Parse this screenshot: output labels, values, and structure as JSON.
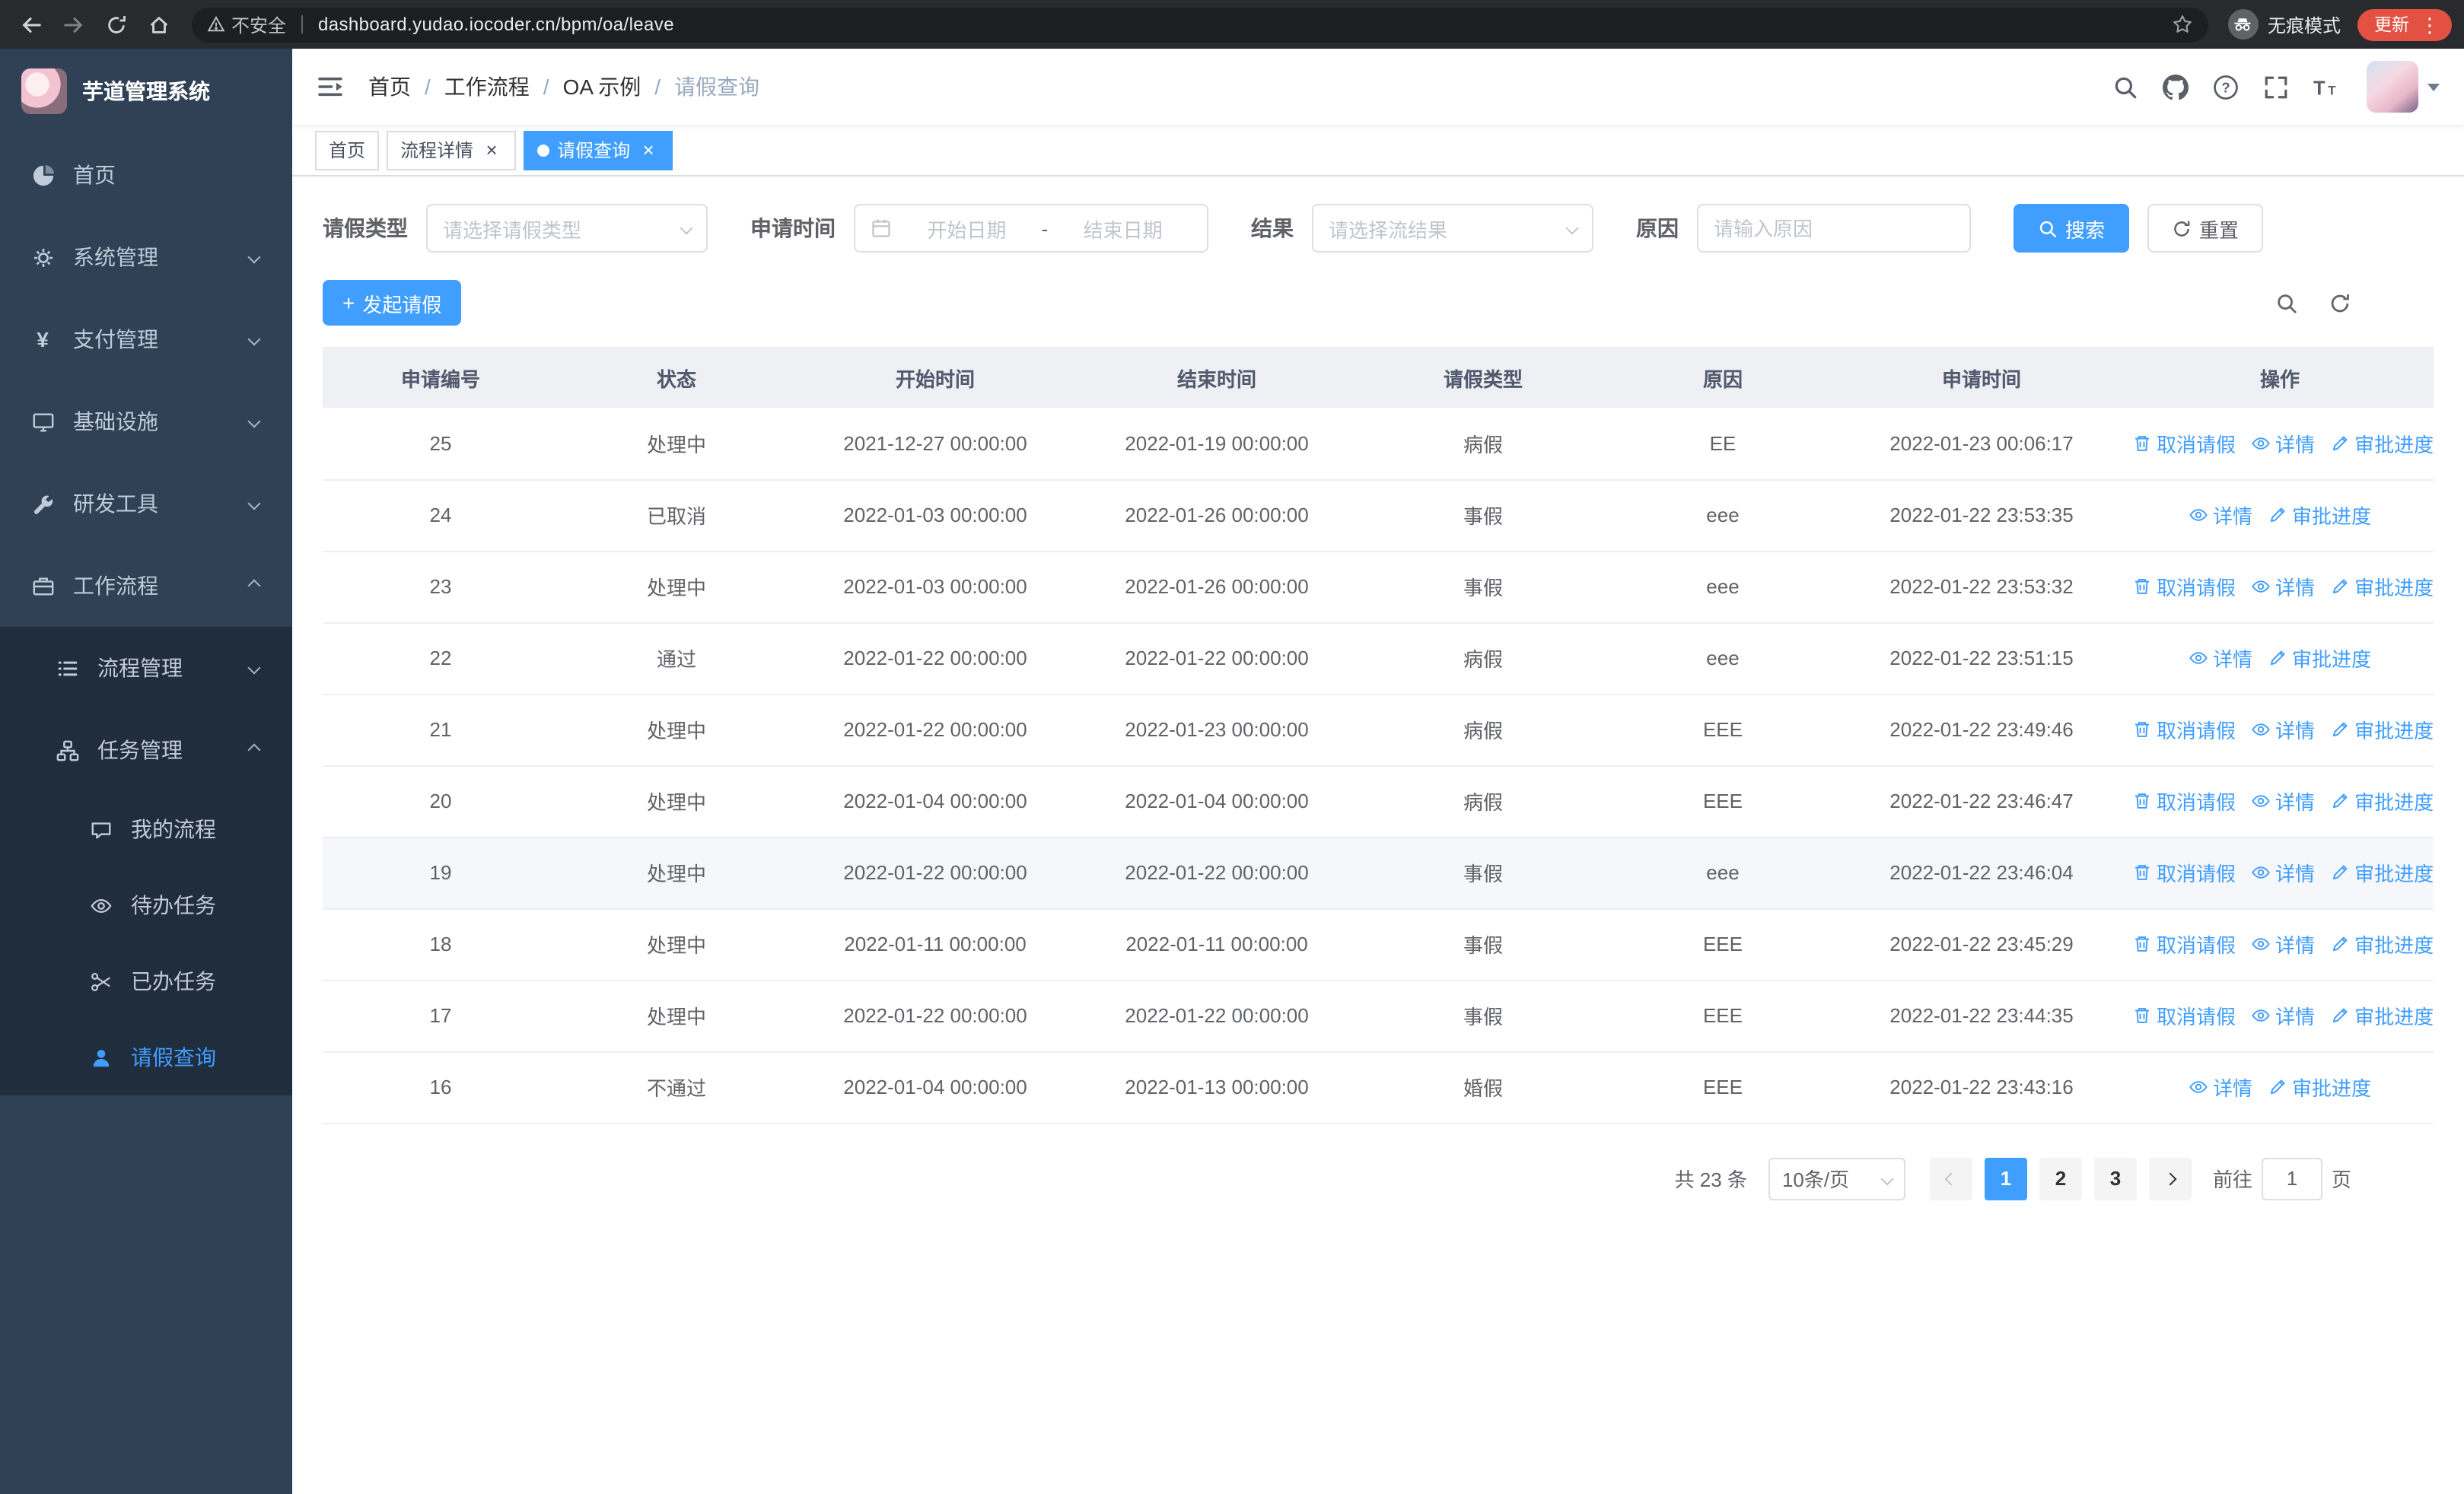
{
  "colors": {
    "primary": "#409eff",
    "sidebar_bg": "#304156",
    "submenu_bg": "#1f2d3d",
    "table_border": "#ebeef5",
    "header_bg": "#eef0f4"
  },
  "browser": {
    "security_warning": "不安全",
    "url": "dashboard.yudao.iocoder.cn/bpm/oa/leave",
    "incognito_label": "无痕模式",
    "update_label": "更新"
  },
  "sidebar": {
    "title": "芋道管理系统",
    "menu": [
      {
        "id": "home",
        "label": "首页",
        "icon": "dashboard"
      },
      {
        "id": "system",
        "label": "系统管理",
        "icon": "gear",
        "group": true
      },
      {
        "id": "payment",
        "label": "支付管理",
        "icon": "yen",
        "group": true
      },
      {
        "id": "infrastructure",
        "label": "基础设施",
        "icon": "monitor",
        "group": true
      },
      {
        "id": "devtools",
        "label": "研发工具",
        "icon": "tools",
        "group": true
      },
      {
        "id": "workflow",
        "label": "工作流程",
        "icon": "briefcase",
        "group": true,
        "expanded": true,
        "children": [
          {
            "id": "process-mgmt",
            "label": "流程管理",
            "icon": "list",
            "group": true
          },
          {
            "id": "task-mgmt",
            "label": "任务管理",
            "icon": "tree",
            "group": true,
            "expanded": true,
            "children": [
              {
                "id": "my-process",
                "label": "我的流程",
                "icon": "chat"
              },
              {
                "id": "todo-tasks",
                "label": "待办任务",
                "icon": "eye"
              },
              {
                "id": "done-tasks",
                "label": "已办任务",
                "icon": "scissors"
              },
              {
                "id": "leave-query",
                "label": "请假查询",
                "icon": "user",
                "active": true
              }
            ]
          }
        ]
      }
    ]
  },
  "header": {
    "breadcrumb": [
      "首页",
      "工作流程",
      "OA 示例",
      "请假查询"
    ],
    "separator": "/"
  },
  "tabs": [
    {
      "name": "home",
      "label": "首页",
      "closable": false,
      "active": false
    },
    {
      "name": "process-detail",
      "label": "流程详情",
      "closable": true,
      "active": false
    },
    {
      "name": "leave-query",
      "label": "请假查询",
      "closable": true,
      "active": true
    }
  ],
  "filters": {
    "leave_type_label": "请假类型",
    "leave_type_placeholder": "请选择请假类型",
    "apply_time_label": "申请时间",
    "start_date_placeholder": "开始日期",
    "range_separator": "-",
    "end_date_placeholder": "结束日期",
    "result_label": "结果",
    "result_placeholder": "请选择流结果",
    "reason_label": "原因",
    "reason_placeholder": "请输入原因",
    "search_label": "搜索",
    "reset_label": "重置"
  },
  "toolbar": {
    "create_label": "发起请假"
  },
  "table": {
    "columns": [
      "申请编号",
      "状态",
      "开始时间",
      "结束时间",
      "请假类型",
      "原因",
      "申请时间",
      "操作"
    ],
    "actions": {
      "cancel": "取消请假",
      "detail": "详情",
      "progress": "审批进度"
    },
    "rows": [
      {
        "id": "25",
        "status": "处理中",
        "start": "2021-12-27 00:00:00",
        "end": "2022-01-19 00:00:00",
        "type": "病假",
        "reason": "EE",
        "applied": "2022-01-23 00:06:17",
        "cancellable": true
      },
      {
        "id": "24",
        "status": "已取消",
        "start": "2022-01-03 00:00:00",
        "end": "2022-01-26 00:00:00",
        "type": "事假",
        "reason": "eee",
        "applied": "2022-01-22 23:53:35",
        "cancellable": false
      },
      {
        "id": "23",
        "status": "处理中",
        "start": "2022-01-03 00:00:00",
        "end": "2022-01-26 00:00:00",
        "type": "事假",
        "reason": "eee",
        "applied": "2022-01-22 23:53:32",
        "cancellable": true
      },
      {
        "id": "22",
        "status": "通过",
        "start": "2022-01-22 00:00:00",
        "end": "2022-01-22 00:00:00",
        "type": "病假",
        "reason": "eee",
        "applied": "2022-01-22 23:51:15",
        "cancellable": false
      },
      {
        "id": "21",
        "status": "处理中",
        "start": "2022-01-22 00:00:00",
        "end": "2022-01-23 00:00:00",
        "type": "病假",
        "reason": "EEE",
        "applied": "2022-01-22 23:49:46",
        "cancellable": true
      },
      {
        "id": "20",
        "status": "处理中",
        "start": "2022-01-04 00:00:00",
        "end": "2022-01-04 00:00:00",
        "type": "病假",
        "reason": "EEE",
        "applied": "2022-01-22 23:46:47",
        "cancellable": true
      },
      {
        "id": "19",
        "status": "处理中",
        "start": "2022-01-22 00:00:00",
        "end": "2022-01-22 00:00:00",
        "type": "事假",
        "reason": "eee",
        "applied": "2022-01-22 23:46:04",
        "cancellable": true,
        "highlighted": true
      },
      {
        "id": "18",
        "status": "处理中",
        "start": "2022-01-11 00:00:00",
        "end": "2022-01-11 00:00:00",
        "type": "事假",
        "reason": "EEE",
        "applied": "2022-01-22 23:45:29",
        "cancellable": true
      },
      {
        "id": "17",
        "status": "处理中",
        "start": "2022-01-22 00:00:00",
        "end": "2022-01-22 00:00:00",
        "type": "事假",
        "reason": "EEE",
        "applied": "2022-01-22 23:44:35",
        "cancellable": true
      },
      {
        "id": "16",
        "status": "不通过",
        "start": "2022-01-04 00:00:00",
        "end": "2022-01-13 00:00:00",
        "type": "婚假",
        "reason": "EEE",
        "applied": "2022-01-22 23:43:16",
        "cancellable": false
      }
    ]
  },
  "pagination": {
    "total_text": "共 23 条",
    "page_size": "10条/页",
    "pages": [
      "1",
      "2",
      "3"
    ],
    "active_page": "1",
    "goto_label": "前往",
    "goto_value": "1",
    "goto_unit": "页"
  }
}
